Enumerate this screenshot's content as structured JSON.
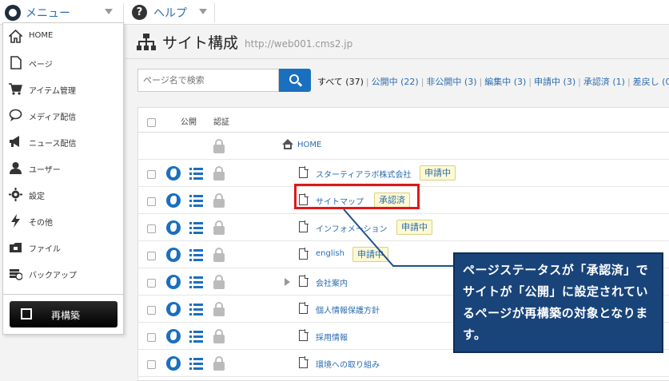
{
  "topbar": {
    "menu_label": "メニュー",
    "help_label": "ヘルプ",
    "menu_icon": "cms-logo-icon",
    "help_icon": "question-circle-icon"
  },
  "page": {
    "title": "サイト構成",
    "url": "http://web001.cms2.jp",
    "title_icon": "sitemap-icon"
  },
  "search": {
    "placeholder": "ページ名で検索"
  },
  "filters": {
    "all": "すべて",
    "all_count": "(37)",
    "items": [
      {
        "label": "公開中",
        "count": "(22)"
      },
      {
        "label": "非公開中",
        "count": "(3)"
      },
      {
        "label": "編集中",
        "count": "(3)"
      },
      {
        "label": "申請中",
        "count": "(3)"
      },
      {
        "label": "承認済",
        "count": "(1)"
      },
      {
        "label": "差戻し",
        "count": "(0"
      }
    ]
  },
  "table": {
    "col_publish": "公開",
    "col_auth": "認証",
    "rows": [
      {
        "name": "HOME",
        "badge": ""
      },
      {
        "name": "スターティアラボ株式会社",
        "badge": "申請中"
      },
      {
        "name": "サイトマップ",
        "badge": "承認済"
      },
      {
        "name": "インフォメーション",
        "badge": "申請中"
      },
      {
        "name": "english",
        "badge": "申請中"
      },
      {
        "name": "会社案内",
        "badge": ""
      },
      {
        "name": "個人情報保護方針",
        "badge": ""
      },
      {
        "name": "採用情報",
        "badge": ""
      },
      {
        "name": "環境への取り組み",
        "badge": ""
      }
    ]
  },
  "callout": {
    "text": "ページステータスが「承認済」でサイトが「公開」に設定されているページが再構築の対象となります。"
  },
  "menu": {
    "items": [
      {
        "label": "HOME",
        "icon": "home-icon"
      },
      {
        "label": "ページ",
        "icon": "page-icon"
      },
      {
        "label": "アイテム管理",
        "icon": "cart-icon"
      },
      {
        "label": "メディア配信",
        "icon": "speech-bubble-icon"
      },
      {
        "label": "ニュース配信",
        "icon": "megaphone-icon"
      },
      {
        "label": "ユーザー",
        "icon": "user-icon"
      },
      {
        "label": "設定",
        "icon": "gear-icon"
      },
      {
        "label": "その他",
        "icon": "lightning-icon"
      },
      {
        "label": "ファイル",
        "icon": "folder-icon"
      },
      {
        "label": "バックアップ",
        "icon": "backup-icon"
      }
    ],
    "rebuild_label": "再構築"
  },
  "colors": {
    "accent": "#1a6fbf",
    "highlight": "#e01818",
    "callout_bg": "#19447a"
  }
}
